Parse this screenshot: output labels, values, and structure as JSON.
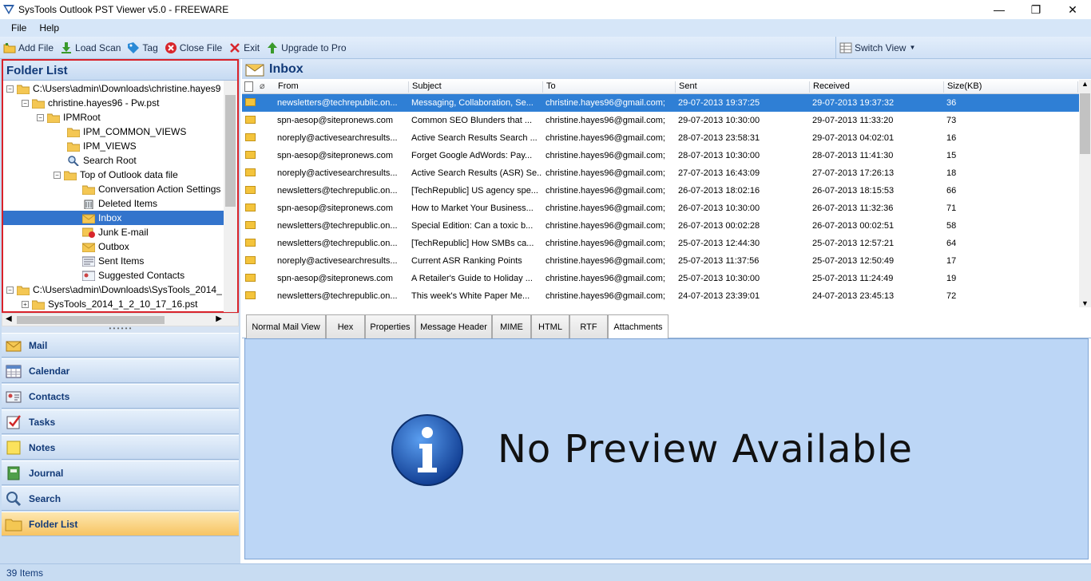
{
  "window": {
    "title": "SysTools Outlook PST Viewer v5.0 - FREEWARE",
    "minimize": "—",
    "maximize": "❐",
    "close": "✕"
  },
  "menu": [
    "File",
    "Help"
  ],
  "toolbar": {
    "add_file": "Add File",
    "load_scan": "Load Scan",
    "tag": "Tag",
    "close_file": "Close File",
    "exit": "Exit",
    "upgrade": "Upgrade to Pro",
    "switch_view": "Switch View"
  },
  "folder_list": {
    "title": "Folder List",
    "items": [
      {
        "label": "C:\\Users\\admin\\Downloads\\christine.hayes9"
      },
      {
        "label": "christine.hayes96 - Pw.pst"
      },
      {
        "label": "IPMRoot"
      },
      {
        "label": "IPM_COMMON_VIEWS"
      },
      {
        "label": "IPM_VIEWS"
      },
      {
        "label": "Search Root"
      },
      {
        "label": "Top of Outlook data file"
      },
      {
        "label": "Conversation Action Settings"
      },
      {
        "label": "Deleted Items"
      },
      {
        "label": "Inbox"
      },
      {
        "label": "Junk E-mail"
      },
      {
        "label": "Outbox"
      },
      {
        "label": "Sent Items"
      },
      {
        "label": "Suggested Contacts"
      },
      {
        "label": "C:\\Users\\admin\\Downloads\\SysTools_2014_"
      },
      {
        "label": "SysTools_2014_1_2_10_17_16.pst"
      }
    ]
  },
  "nav": [
    "Mail",
    "Calendar",
    "Contacts",
    "Tasks",
    "Notes",
    "Journal",
    "Search",
    "Folder List"
  ],
  "inbox": {
    "title": "Inbox",
    "columns": [
      "From",
      "Subject",
      "To",
      "Sent",
      "Received",
      "Size(KB)"
    ],
    "rows": [
      {
        "from": "newsletters@techrepublic.on...",
        "subject": "Messaging, Collaboration, Se...",
        "to": "christine.hayes96@gmail.com;",
        "sent": "29-07-2013 19:37:25",
        "received": "29-07-2013 19:37:32",
        "size": "36"
      },
      {
        "from": "spn-aesop@sitepronews.com",
        "subject": "Common SEO Blunders that ...",
        "to": "christine.hayes96@gmail.com;",
        "sent": "29-07-2013 10:30:00",
        "received": "29-07-2013 11:33:20",
        "size": "73"
      },
      {
        "from": "noreply@activesearchresults...",
        "subject": "Active Search Results Search ...",
        "to": "christine.hayes96@gmail.com;",
        "sent": "28-07-2013 23:58:31",
        "received": "29-07-2013 04:02:01",
        "size": "16"
      },
      {
        "from": "spn-aesop@sitepronews.com",
        "subject": "Forget Google AdWords: Pay...",
        "to": "christine.hayes96@gmail.com;",
        "sent": "28-07-2013 10:30:00",
        "received": "28-07-2013 11:41:30",
        "size": "15"
      },
      {
        "from": "noreply@activesearchresults...",
        "subject": "Active Search Results (ASR) Se...",
        "to": "christine.hayes96@gmail.com;",
        "sent": "27-07-2013 16:43:09",
        "received": "27-07-2013 17:26:13",
        "size": "18"
      },
      {
        "from": "newsletters@techrepublic.on...",
        "subject": "[TechRepublic] US agency spe...",
        "to": "christine.hayes96@gmail.com;",
        "sent": "26-07-2013 18:02:16",
        "received": "26-07-2013 18:15:53",
        "size": "66"
      },
      {
        "from": "spn-aesop@sitepronews.com",
        "subject": "How to Market Your Business...",
        "to": "christine.hayes96@gmail.com;",
        "sent": "26-07-2013 10:30:00",
        "received": "26-07-2013 11:32:36",
        "size": "71"
      },
      {
        "from": "newsletters@techrepublic.on...",
        "subject": "Special Edition: Can a toxic b...",
        "to": "christine.hayes96@gmail.com;",
        "sent": "26-07-2013 00:02:28",
        "received": "26-07-2013 00:02:51",
        "size": "58"
      },
      {
        "from": "newsletters@techrepublic.on...",
        "subject": "[TechRepublic] How SMBs ca...",
        "to": "christine.hayes96@gmail.com;",
        "sent": "25-07-2013 12:44:30",
        "received": "25-07-2013 12:57:21",
        "size": "64"
      },
      {
        "from": "noreply@activesearchresults...",
        "subject": "Current ASR Ranking Points",
        "to": "christine.hayes96@gmail.com;",
        "sent": "25-07-2013 11:37:56",
        "received": "25-07-2013 12:50:49",
        "size": "17"
      },
      {
        "from": "spn-aesop@sitepronews.com",
        "subject": "A Retailer's Guide to Holiday ...",
        "to": "christine.hayes96@gmail.com;",
        "sent": "25-07-2013 10:30:00",
        "received": "25-07-2013 11:24:49",
        "size": "19"
      },
      {
        "from": "newsletters@techrepublic.on...",
        "subject": "This week's White Paper Me...",
        "to": "christine.hayes96@gmail.com;",
        "sent": "24-07-2013 23:39:01",
        "received": "24-07-2013 23:45:13",
        "size": "72"
      }
    ]
  },
  "tabs": [
    "Normal Mail View",
    "Hex",
    "Properties",
    "Message Header",
    "MIME",
    "HTML",
    "RTF",
    "Attachments"
  ],
  "preview": {
    "message": "No Preview Available"
  },
  "status": {
    "items": "39 Items"
  },
  "colors": {
    "selection": "#2f7fd5",
    "accent": "#123a78",
    "highlight_border": "#d9222a"
  }
}
